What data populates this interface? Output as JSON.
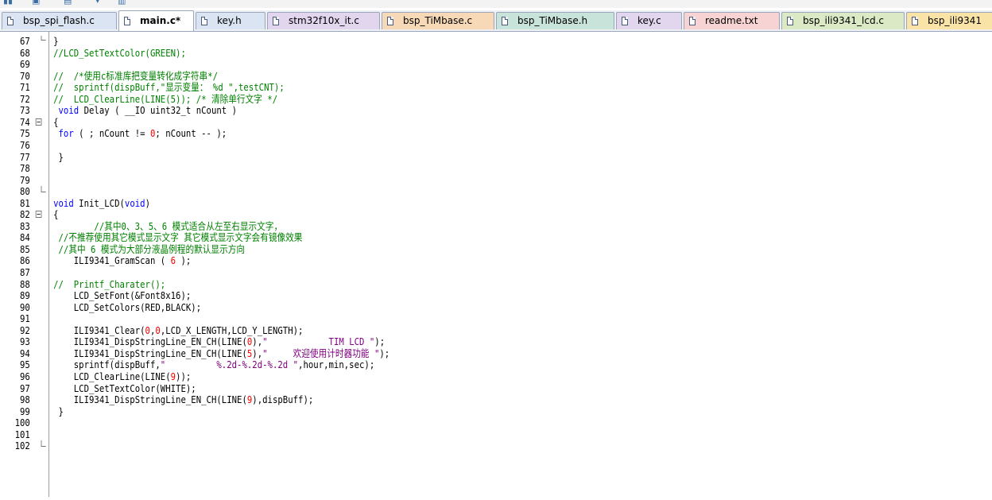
{
  "tabs": [
    {
      "label": "bsp_spi_flash.c",
      "color": "#dbe4f3",
      "active": false
    },
    {
      "label": "main.c*",
      "color": "#ffffff",
      "active": true
    },
    {
      "label": "key.h",
      "color": "#dbe4f3",
      "active": false
    },
    {
      "label": "stm32f10x_it.c",
      "color": "#e2d6ef",
      "active": false
    },
    {
      "label": "bsp_TiMbase.c",
      "color": "#f7d9b7",
      "active": false
    },
    {
      "label": "bsp_TiMbase.h",
      "color": "#c8e3da",
      "active": false
    },
    {
      "label": "key.c",
      "color": "#e2d6ef",
      "active": false
    },
    {
      "label": "readme.txt",
      "color": "#f7d3d3",
      "active": false
    },
    {
      "label": "bsp_ili9341_lcd.c",
      "color": "#dbe9c4",
      "active": false
    },
    {
      "label": "bsp_ili9341",
      "color": "#f9e3a6",
      "active": false
    }
  ],
  "lines": [
    {
      "n": "67",
      "fold": "end-top",
      "tokens": [
        {
          "t": "}",
          "c": "plain"
        }
      ],
      "indent": 0
    },
    {
      "n": "68",
      "fold": "",
      "tokens": [
        {
          "t": "//LCD_SetTextColor(GREEN);",
          "c": "comment"
        }
      ],
      "indent": 0
    },
    {
      "n": "69",
      "fold": "",
      "tokens": [],
      "indent": 0
    },
    {
      "n": "70",
      "fold": "",
      "tokens": [
        {
          "t": "//  /*使用c标准库把变量转化成字符串*/",
          "c": "comment"
        }
      ],
      "indent": 0
    },
    {
      "n": "71",
      "fold": "",
      "tokens": [
        {
          "t": "//  sprintf(dispBuff,\"显示变量： %d \",testCNT);",
          "c": "comment"
        }
      ],
      "indent": 0
    },
    {
      "n": "72",
      "fold": "",
      "tokens": [
        {
          "t": "//  LCD_ClearLine(LINE(5)); /* 清除单行文字 */",
          "c": "comment"
        }
      ],
      "indent": 0
    },
    {
      "n": "73",
      "fold": "",
      "tokens": [
        {
          "t": " void",
          "c": "kw"
        },
        {
          "t": " Delay ( __IO uint32_t nCount )",
          "c": "plain"
        }
      ],
      "indent": 0
    },
    {
      "n": "74",
      "fold": "box",
      "tokens": [
        {
          "t": "{",
          "c": "plain"
        }
      ],
      "indent": 0
    },
    {
      "n": "75",
      "fold": "",
      "tokens": [
        {
          "t": " for",
          "c": "kw"
        },
        {
          "t": " ( ; nCount != ",
          "c": "plain"
        },
        {
          "t": "0",
          "c": "num"
        },
        {
          "t": "; nCount -- );",
          "c": "plain"
        }
      ],
      "indent": 0
    },
    {
      "n": "76",
      "fold": "",
      "tokens": [],
      "indent": 0
    },
    {
      "n": "77",
      "fold": "",
      "tokens": [
        {
          "t": " }",
          "c": "plain"
        }
      ],
      "indent": 0
    },
    {
      "n": "78",
      "fold": "",
      "tokens": [],
      "indent": 0
    },
    {
      "n": "79",
      "fold": "",
      "tokens": [],
      "indent": 0
    },
    {
      "n": "80",
      "fold": "end-bottom",
      "tokens": [],
      "indent": 0
    },
    {
      "n": "81",
      "fold": "",
      "tokens": [
        {
          "t": "void",
          "c": "kw"
        },
        {
          "t": " Init_LCD(",
          "c": "plain"
        },
        {
          "t": "void",
          "c": "kw"
        },
        {
          "t": ")",
          "c": "plain"
        }
      ],
      "indent": 0
    },
    {
      "n": "82",
      "fold": "box",
      "tokens": [
        {
          "t": "{",
          "c": "plain"
        }
      ],
      "indent": 0
    },
    {
      "n": "83",
      "fold": "",
      "tokens": [
        {
          "t": "        //其中0、3、5、6 模式适合从左至右显示文字，",
          "c": "comment"
        }
      ],
      "indent": 0
    },
    {
      "n": "84",
      "fold": "",
      "tokens": [
        {
          "t": " //不推荐使用其它模式显示文字 其它模式显示文字会有镜像效果",
          "c": "comment"
        }
      ],
      "indent": 0
    },
    {
      "n": "85",
      "fold": "",
      "tokens": [
        {
          "t": " //其中 6 模式为大部分液晶例程的默认显示方向",
          "c": "comment"
        }
      ],
      "indent": 0
    },
    {
      "n": "86",
      "fold": "",
      "tokens": [
        {
          "t": "    ILI9341_GramScan ( ",
          "c": "plain"
        },
        {
          "t": "6",
          "c": "num"
        },
        {
          "t": " );",
          "c": "plain"
        }
      ],
      "indent": 0
    },
    {
      "n": "87",
      "fold": "",
      "tokens": [],
      "indent": 0
    },
    {
      "n": "88",
      "fold": "",
      "tokens": [
        {
          "t": "//  Printf_Charater();",
          "c": "comment"
        }
      ],
      "indent": 0
    },
    {
      "n": "89",
      "fold": "",
      "tokens": [
        {
          "t": "    LCD_SetFont(&Font8x16);",
          "c": "plain"
        }
      ],
      "indent": 0
    },
    {
      "n": "90",
      "fold": "",
      "tokens": [
        {
          "t": "    LCD_SetColors(RED,BLACK);",
          "c": "plain"
        }
      ],
      "indent": 0
    },
    {
      "n": "91",
      "fold": "",
      "tokens": [],
      "indent": 0
    },
    {
      "n": "92",
      "fold": "",
      "tokens": [
        {
          "t": "    ILI9341_Clear(",
          "c": "plain"
        },
        {
          "t": "0",
          "c": "num"
        },
        {
          "t": ",",
          "c": "plain"
        },
        {
          "t": "0",
          "c": "num"
        },
        {
          "t": ",LCD_X_LENGTH,LCD_Y_LENGTH);",
          "c": "plain"
        }
      ],
      "indent": 0
    },
    {
      "n": "93",
      "fold": "",
      "tokens": [
        {
          "t": "    ILI9341_DispStringLine_EN_CH(LINE(",
          "c": "plain"
        },
        {
          "t": "0",
          "c": "num"
        },
        {
          "t": "),",
          "c": "plain"
        },
        {
          "t": "\"            TIM LCD \"",
          "c": "str"
        },
        {
          "t": ");",
          "c": "plain"
        }
      ],
      "indent": 0
    },
    {
      "n": "94",
      "fold": "",
      "tokens": [
        {
          "t": "    ILI9341_DispStringLine_EN_CH(LINE(",
          "c": "plain"
        },
        {
          "t": "5",
          "c": "num"
        },
        {
          "t": "),",
          "c": "plain"
        },
        {
          "t": "\"     欢迎使用计时器功能 \"",
          "c": "str"
        },
        {
          "t": ");",
          "c": "plain"
        }
      ],
      "indent": 0
    },
    {
      "n": "95",
      "fold": "",
      "tokens": [
        {
          "t": "    sprintf(dispBuff,",
          "c": "plain"
        },
        {
          "t": "\"          %.2d-%.2d-%.2d \"",
          "c": "str"
        },
        {
          "t": ",hour,min,sec);",
          "c": "plain"
        }
      ],
      "indent": 0
    },
    {
      "n": "96",
      "fold": "",
      "tokens": [
        {
          "t": "    LCD_ClearLine(LINE(",
          "c": "plain"
        },
        {
          "t": "9",
          "c": "num"
        },
        {
          "t": "));",
          "c": "plain"
        }
      ],
      "indent": 0
    },
    {
      "n": "97",
      "fold": "",
      "tokens": [
        {
          "t": "    LCD_SetTextColor(WHITE);",
          "c": "plain"
        }
      ],
      "indent": 0
    },
    {
      "n": "98",
      "fold": "",
      "tokens": [
        {
          "t": "    ILI9341_DispStringLine_EN_CH(LINE(",
          "c": "plain"
        },
        {
          "t": "9",
          "c": "num"
        },
        {
          "t": "),dispBuff);",
          "c": "plain"
        }
      ],
      "indent": 0
    },
    {
      "n": "99",
      "fold": "",
      "tokens": [
        {
          "t": " }",
          "c": "plain"
        }
      ],
      "indent": 0
    },
    {
      "n": "100",
      "fold": "",
      "tokens": [],
      "indent": 0
    },
    {
      "n": "101",
      "fold": "",
      "tokens": [],
      "indent": 0
    },
    {
      "n": "102",
      "fold": "end-bottom",
      "tokens": [],
      "indent": 0
    }
  ],
  "colors": {
    "comment": "#008000",
    "keyword": "#0000ff",
    "number": "#ff0000",
    "string": "#800080",
    "plain": "#000000"
  }
}
